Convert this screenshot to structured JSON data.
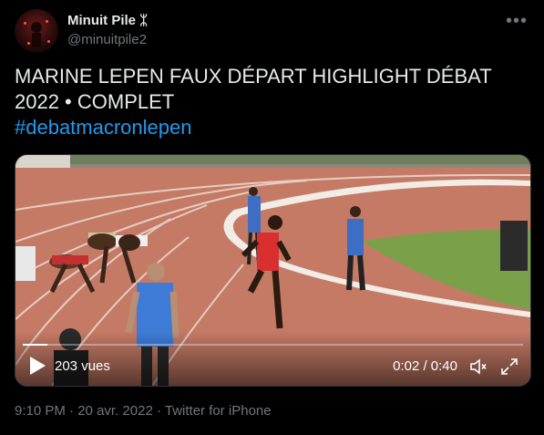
{
  "author": {
    "display_name": "Minuit Pile",
    "badge": "ᛯ",
    "handle": "@minuitpile2"
  },
  "more_icon": "more-icon",
  "tweet": {
    "text": "MARINE LEPEN FAUX DÉPART HIGHLIGHT DÉBAT 2022 • COMPLET",
    "hashtag": "#debatmacronlepen"
  },
  "video": {
    "views": "203 vues",
    "time": "0:02 / 0:40",
    "progress": 0.05
  },
  "meta": {
    "time": "9:10 PM",
    "separator": "·",
    "date": "20 avr. 2022",
    "source": "Twitter for iPhone"
  },
  "colors": {
    "background": "#000000",
    "text": "#e7e9ea",
    "secondary": "#71767b",
    "link": "#1d9bf0"
  }
}
